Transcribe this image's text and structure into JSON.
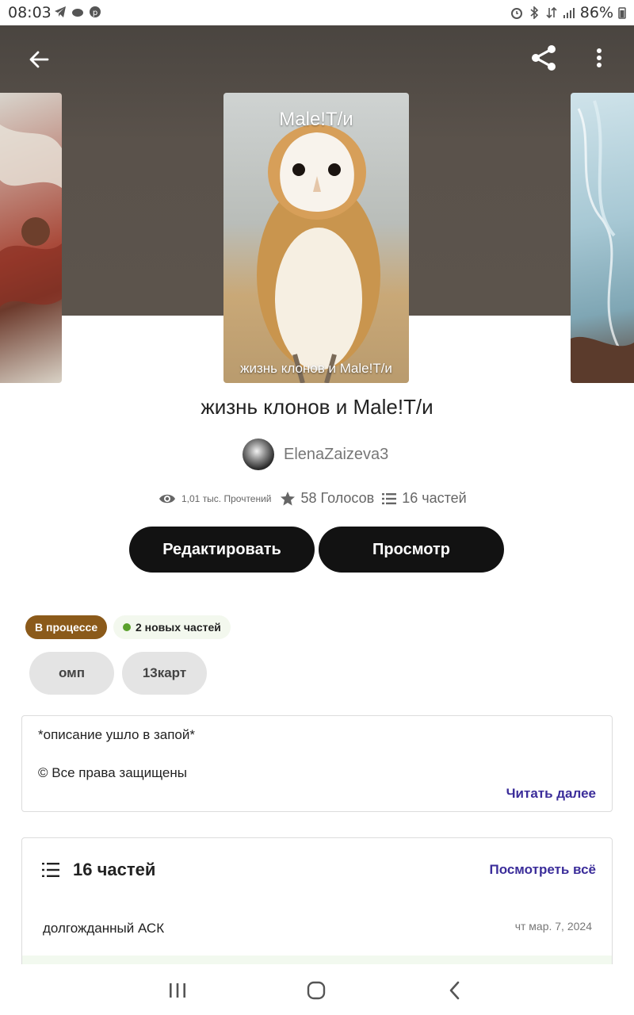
{
  "status_bar": {
    "time": "08:03",
    "battery": "86%"
  },
  "story": {
    "cover_title": "Male!T/и",
    "cover_subtitle": "жизнь клонов и Male!T/и",
    "title": "жизнь клонов и Male!T/и",
    "author": "ElenaZaizeva3",
    "reads": "1,01 тыс. Прочтений",
    "votes": "58 Голосов",
    "parts": "16 частей"
  },
  "actions": {
    "edit_label": "Редактировать",
    "view_label": "Просмотр"
  },
  "badges": {
    "status": "В процессе",
    "new_parts": "2 новых частей"
  },
  "tags": [
    "омп",
    "13карт"
  ],
  "description": {
    "line1": "*описание ушло в запой*",
    "line2": "© Все права защищены",
    "read_more": "Читать далее"
  },
  "parts_section": {
    "title": "16 частей",
    "see_all": "Посмотреть всё",
    "items": [
      {
        "name": "долгожданный АСК",
        "date": "чт мар. 7, 2024"
      }
    ]
  },
  "colors": {
    "status_badge": "#8b5a1a",
    "link": "#3b2d9a",
    "button": "#121212"
  }
}
